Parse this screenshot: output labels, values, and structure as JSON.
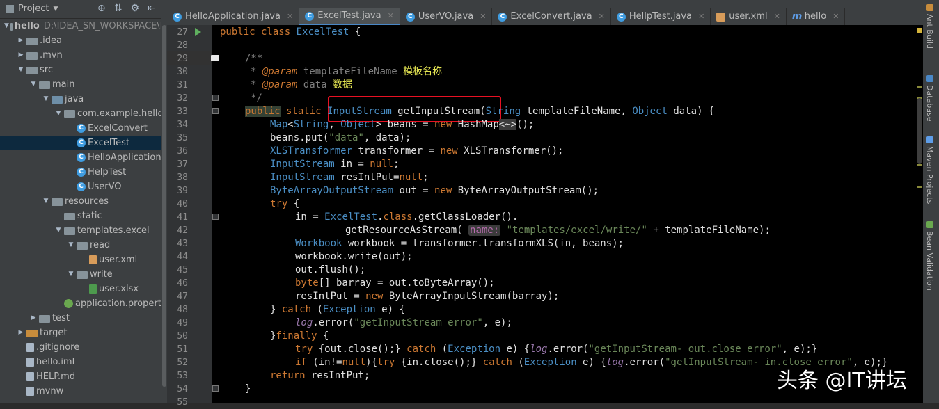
{
  "project": {
    "title": "Project",
    "tree": [
      {
        "label": "hello",
        "path": "D:\\IDEA_SN_WORKSPACE\\h",
        "indent": 0,
        "icon": "folder",
        "arrow": "down"
      },
      {
        "label": ".idea",
        "indent": 1,
        "icon": "folder",
        "arrow": "right"
      },
      {
        "label": ".mvn",
        "indent": 1,
        "icon": "folder",
        "arrow": "right"
      },
      {
        "label": "src",
        "indent": 1,
        "icon": "folder",
        "arrow": "down"
      },
      {
        "label": "main",
        "indent": 2,
        "icon": "folder",
        "arrow": "down"
      },
      {
        "label": "java",
        "indent": 3,
        "icon": "folder-src",
        "arrow": "down"
      },
      {
        "label": "com.example.hello",
        "indent": 4,
        "icon": "package",
        "arrow": "down"
      },
      {
        "label": "ExcelConvert",
        "indent": 5,
        "icon": "class"
      },
      {
        "label": "ExcelTest",
        "indent": 5,
        "icon": "class",
        "selected": true
      },
      {
        "label": "HelloApplication",
        "indent": 5,
        "icon": "class"
      },
      {
        "label": "HelpTest",
        "indent": 5,
        "icon": "class"
      },
      {
        "label": "UserVO",
        "indent": 5,
        "icon": "class"
      },
      {
        "label": "resources",
        "indent": 3,
        "icon": "folder",
        "arrow": "down"
      },
      {
        "label": "static",
        "indent": 4,
        "icon": "folder"
      },
      {
        "label": "templates.excel",
        "indent": 4,
        "icon": "folder",
        "arrow": "down"
      },
      {
        "label": "read",
        "indent": 5,
        "icon": "folder",
        "arrow": "down"
      },
      {
        "label": "user.xml",
        "indent": 6,
        "icon": "xml"
      },
      {
        "label": "write",
        "indent": 5,
        "icon": "folder",
        "arrow": "down"
      },
      {
        "label": "user.xlsx",
        "indent": 6,
        "icon": "xlsx"
      },
      {
        "label": "application.properties",
        "indent": 4,
        "icon": "spring"
      },
      {
        "label": "test",
        "indent": 2,
        "icon": "folder",
        "arrow": "right"
      },
      {
        "label": "target",
        "indent": 1,
        "icon": "folder-orange",
        "arrow": "right"
      },
      {
        "label": ".gitignore",
        "indent": 1,
        "icon": "file"
      },
      {
        "label": "hello.iml",
        "indent": 1,
        "icon": "file"
      },
      {
        "label": "HELP.md",
        "indent": 1,
        "icon": "file"
      },
      {
        "label": "mvnw",
        "indent": 1,
        "icon": "file"
      }
    ]
  },
  "tabs": [
    {
      "label": "HelloApplication.java",
      "icon": "class"
    },
    {
      "label": "ExcelTest.java",
      "icon": "class",
      "active": true
    },
    {
      "label": "UserVO.java",
      "icon": "class"
    },
    {
      "label": "ExcelConvert.java",
      "icon": "class"
    },
    {
      "label": "HellpTest.java",
      "icon": "class"
    },
    {
      "label": "user.xml",
      "icon": "xml"
    },
    {
      "label": "hello",
      "icon": "maven"
    }
  ],
  "editor": {
    "line_numbers": [
      "27",
      "28",
      "29",
      "30",
      "31",
      "32",
      "33",
      "34",
      "35",
      "36",
      "37",
      "38",
      "39",
      "40",
      "41",
      "42",
      "43",
      "44",
      "45",
      "46",
      "47",
      "48",
      "49",
      "50",
      "51",
      "52",
      "53",
      "54",
      "55"
    ],
    "param_hint": "name:"
  },
  "right_tools": [
    "Ant Build",
    "Database",
    "Maven Projects",
    "Bean Validation"
  ],
  "watermark": "头条 @IT讲坛"
}
